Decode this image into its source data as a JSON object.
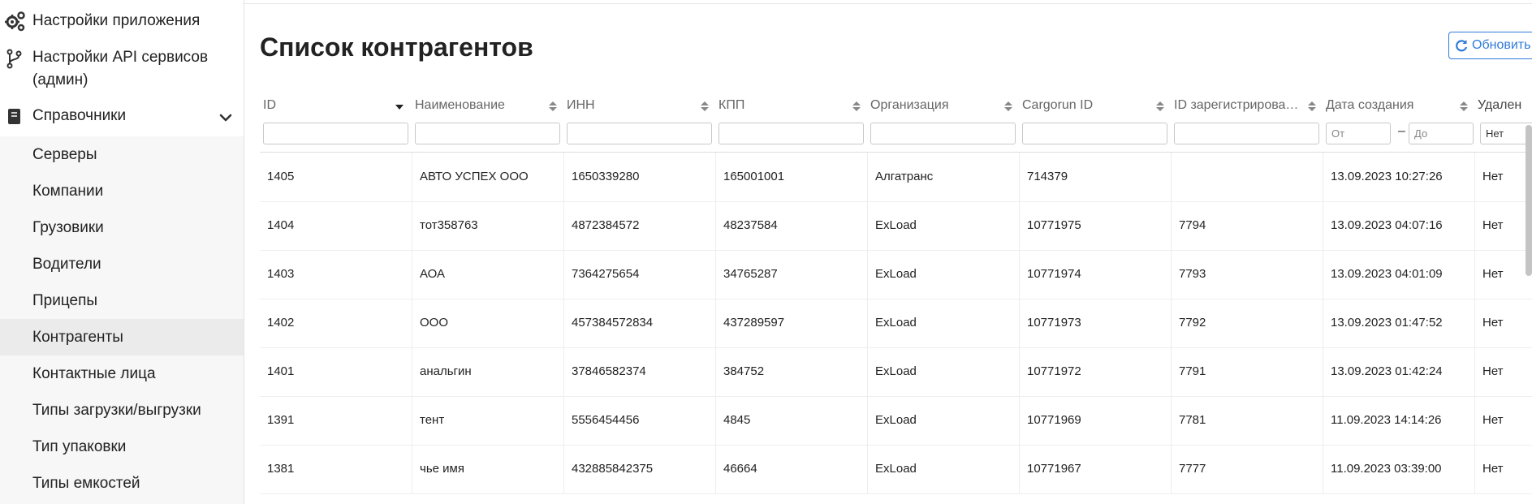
{
  "sidebar": {
    "app_settings": "Настройки приложения",
    "api_settings": "Настройки API сервисов (админ)",
    "references": "Справочники",
    "sub_items": [
      "Серверы",
      "Компании",
      "Грузовики",
      "Водители",
      "Прицепы",
      "Контрагенты",
      "Контактные лица",
      "Типы загрузки/выгрузки",
      "Тип упаковки",
      "Типы емкостей"
    ],
    "active_item": "Контрагенты"
  },
  "page": {
    "title": "Список контрагентов",
    "refresh_label": "Обновить"
  },
  "table": {
    "columns": [
      "ID",
      "Наименование",
      "ИНН",
      "КПП",
      "Организация",
      "Cargorun ID",
      "ID зарегистрирова…",
      "Дата создания",
      "Удален"
    ],
    "filters": {
      "date_from_placeholder": "От",
      "date_to_placeholder": "До",
      "date_separator": "–",
      "deleted_value": "Нет"
    },
    "rows": [
      [
        "1405",
        "АВТО УСПЕХ ООО",
        "1650339280",
        "165001001",
        "Алгатранс",
        "714379",
        "",
        "13.09.2023 10:27:26",
        "Нет"
      ],
      [
        "1404",
        "тот358763",
        "4872384572",
        "48237584",
        "ExLoad",
        "10771975",
        "7794",
        "13.09.2023 04:07:16",
        "Нет"
      ],
      [
        "1403",
        "АОА",
        "7364275654",
        "34765287",
        "ExLoad",
        "10771974",
        "7793",
        "13.09.2023 04:01:09",
        "Нет"
      ],
      [
        "1402",
        "ООО",
        "457384572834",
        "437289597",
        "ExLoad",
        "10771973",
        "7792",
        "13.09.2023 01:47:52",
        "Нет"
      ],
      [
        "1401",
        "анальгин",
        "37846582374",
        "384752",
        "ExLoad",
        "10771972",
        "7791",
        "13.09.2023 01:42:24",
        "Нет"
      ],
      [
        "1391",
        "тент",
        "5556454456",
        "4845",
        "ExLoad",
        "10771969",
        "7781",
        "11.09.2023 14:14:26",
        "Нет"
      ],
      [
        "1381",
        "чье имя",
        "432885842375",
        "46664",
        "ExLoad",
        "10771967",
        "7777",
        "11.09.2023 03:39:00",
        "Нет"
      ]
    ]
  },
  "colors": {
    "accent": "#2f7bd9",
    "active_bg": "#ebebeb",
    "submenu_bg": "#f7f7f7"
  }
}
